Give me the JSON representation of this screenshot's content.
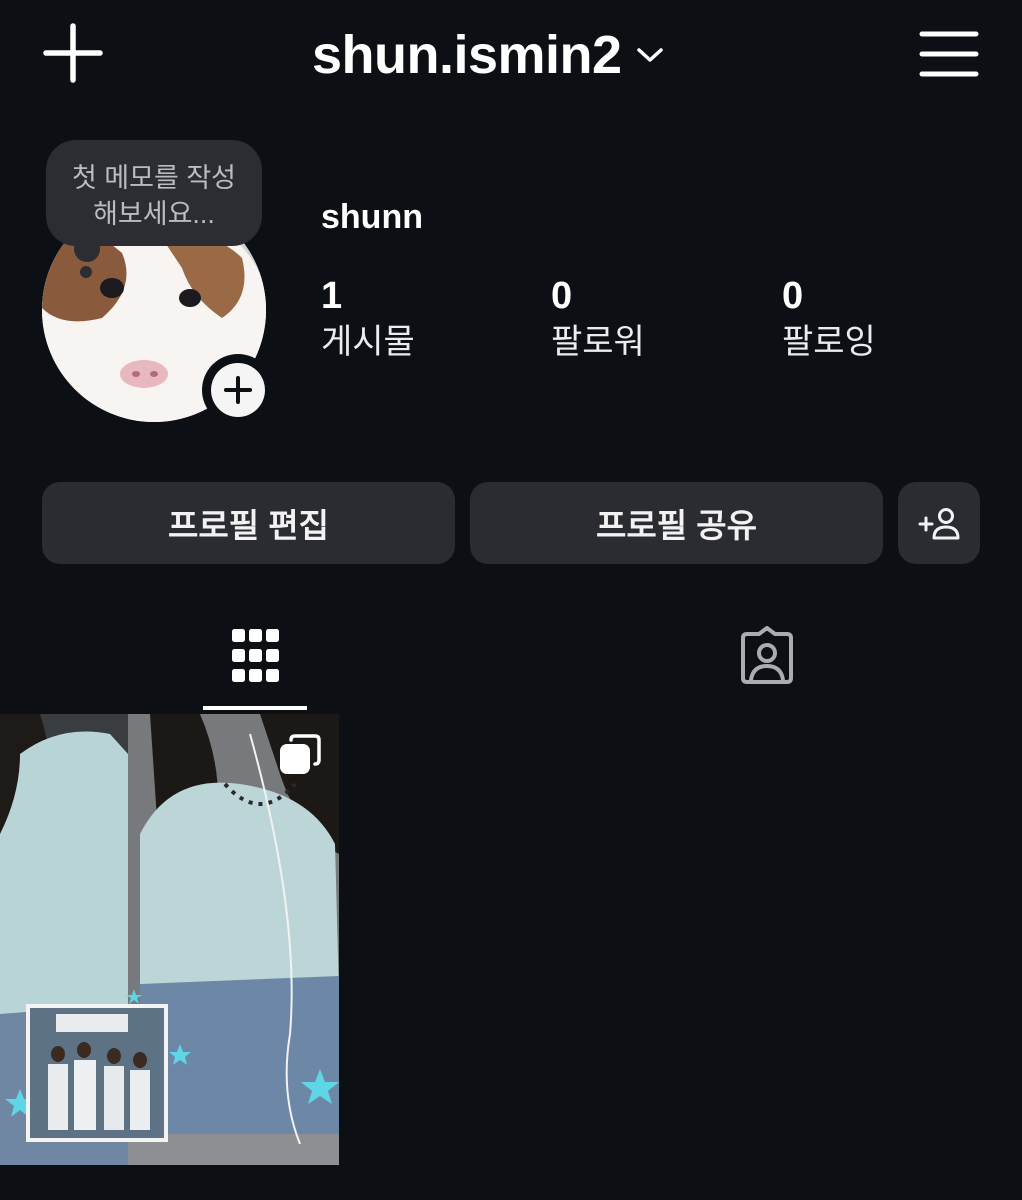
{
  "header": {
    "username": "shun.ismin2",
    "icons": {
      "new_post": "plus-icon",
      "switcher": "chevron-down-icon",
      "menu": "hamburger-menu-icon"
    }
  },
  "profile": {
    "note_line1": "첫 메모를 작성",
    "note_line2": "해보세요...",
    "display_name": "shunn",
    "stats": {
      "posts_count": "1",
      "posts_label": "게시물",
      "followers_count": "0",
      "followers_label": "팔로워",
      "following_count": "0",
      "following_label": "팔로잉"
    }
  },
  "actions": {
    "edit_profile": "프로필 편집",
    "share_profile": "프로필 공유",
    "discover_people_icon": "add-person-icon"
  },
  "tabs": [
    {
      "icon": "grid-icon",
      "selected": true
    },
    {
      "icon": "tagged-person-icon",
      "selected": false
    }
  ],
  "posts": [
    {
      "type": "carousel",
      "badge_icon": "multiple-posts-icon"
    }
  ],
  "colors": {
    "background": "#0c0f14",
    "button": "#2a2c31",
    "note_bubble": "#2b2d33",
    "text": "#ffffff"
  }
}
